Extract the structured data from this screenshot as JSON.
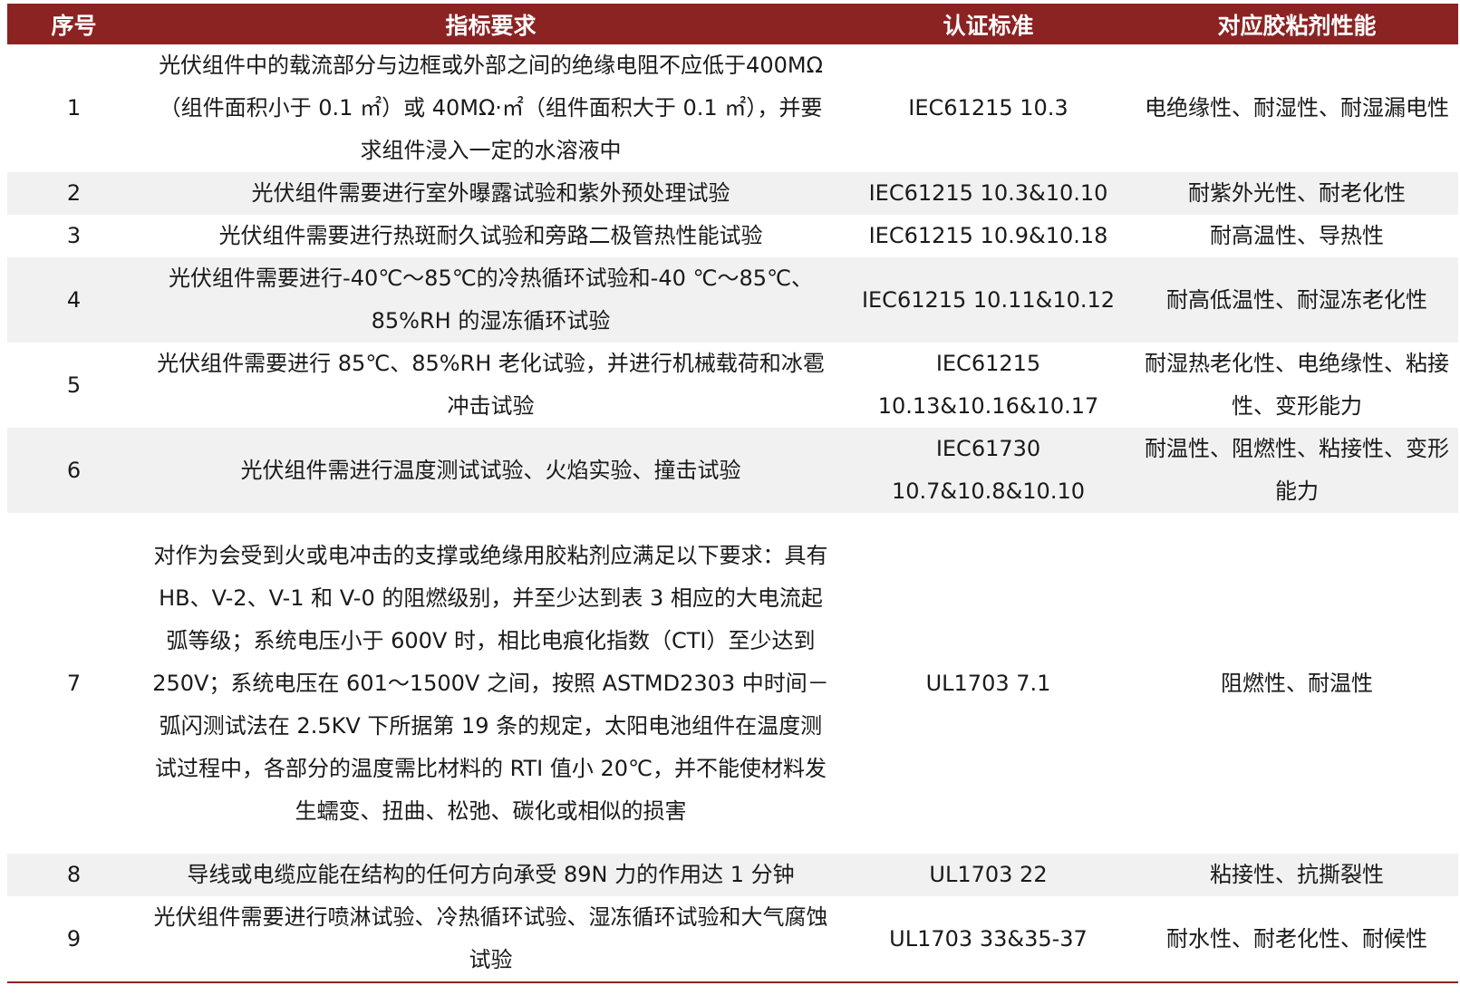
{
  "header": {
    "col_index": "序号",
    "col_requirement": "指标要求",
    "col_standard": "认证标准",
    "col_performance": "对应胶粘剂性能"
  },
  "rows": [
    {
      "index": "1",
      "requirement": "光伏组件中的载流部分与边框或外部之间的绝缘电阻不应低于400MΩ（组件面积小于 0.1 ㎡）或 40MΩ·㎡（组件面积大于 0.1 ㎡），并要求组件浸入一定的水溶液中",
      "standard": "IEC61215 10.3",
      "performance": "电绝缘性、耐湿性、耐湿漏电性"
    },
    {
      "index": "2",
      "requirement": "光伏组件需要进行室外曝露试验和紫外预处理试验",
      "standard": "IEC61215 10.3&10.10",
      "performance": "耐紫外光性、耐老化性"
    },
    {
      "index": "3",
      "requirement": "光伏组件需要进行热斑耐久试验和旁路二极管热性能试验",
      "standard": "IEC61215 10.9&10.18",
      "performance": "耐高温性、导热性"
    },
    {
      "index": "4",
      "requirement": "光伏组件需要进行-40℃～85℃的冷热循环试验和-40 ℃～85℃、85%RH 的湿冻循环试验",
      "standard": "IEC61215 10.11&10.12",
      "performance": "耐高低温性、耐湿冻老化性"
    },
    {
      "index": "5",
      "requirement": "光伏组件需要进行 85℃、85%RH 老化试验，并进行机械载荷和冰雹冲击试验",
      "standard": "IEC61215 10.13&10.16&10.17",
      "performance": "耐湿热老化性、电绝缘性、粘接性、变形能力"
    },
    {
      "index": "6",
      "requirement": "光伏组件需进行温度测试试验、火焰实验、撞击试验",
      "standard": "IEC61730 10.7&10.8&10.10",
      "performance": "耐温性、阻燃性、粘接性、变形能力"
    },
    {
      "index": "7",
      "requirement": "对作为会受到火或电冲击的支撑或绝缘用胶粘剂应满足以下要求：具有 HB、V-2、V-1 和 V-0 的阻燃级别，并至少达到表 3 相应的大电流起弧等级；系统电压小于 600V 时，相比电痕化指数（CTI）至少达到 250V；系统电压在 601～1500V 之间，按照 ASTMD2303 中时间－弧闪测试法在 2.5KV 下所据第 19 条的规定，太阳电池组件在温度测试过程中，各部分的温度需比材料的 RTI 值小 20℃，并不能使材料发生蠕变、扭曲、松弛、碳化或相似的损害",
      "standard": "UL1703 7.1",
      "performance": "阻燃性、耐温性"
    },
    {
      "index": "8",
      "requirement": "导线或电缆应能在结构的任何方向承受 89N 力的作用达 1 分钟",
      "standard": "UL1703 22",
      "performance": "粘接性、抗撕裂性"
    },
    {
      "index": "9",
      "requirement": "光伏组件需要进行喷淋试验、冷热循环试验、湿冻循环试验和大气腐蚀试验",
      "standard": "UL1703 33&35-37",
      "performance": "耐水性、耐老化性、耐候性"
    }
  ]
}
